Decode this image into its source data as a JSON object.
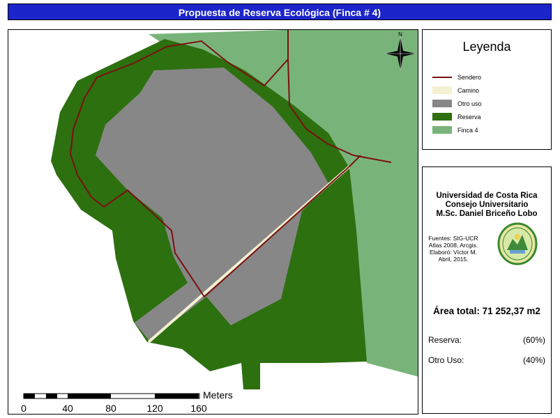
{
  "title": "Propuesta de Reserva Ecológica (Finca # 4)",
  "north_label": "N",
  "legend": {
    "title": "Leyenda",
    "items": [
      {
        "label": "Sendero",
        "color": "#7a1010",
        "kind": "line"
      },
      {
        "label": "Camino",
        "color": "#f4f1d2",
        "kind": "fill"
      },
      {
        "label": "Otro uso",
        "color": "#878787",
        "kind": "fill"
      },
      {
        "label": "Reserva",
        "color": "#2d7010",
        "kind": "fill"
      },
      {
        "label": "Finca 4",
        "color": "#78b47a",
        "kind": "fill"
      }
    ]
  },
  "info": {
    "institution": [
      "Universidad de Costa Rica",
      "Consejo Universitario",
      "M.Sc. Daniel Briceño Lobo"
    ],
    "sources": [
      "Fuentes: SIG-UCR",
      "Atlas 2008, Arcgis.",
      "Elaboró: Víctor M.",
      "Abril, 2015."
    ],
    "area_total": "Área total: 71 252,37 m2",
    "rows": [
      {
        "label": "Reserva:",
        "value": "(60%)"
      },
      {
        "label": "Otro Uso:",
        "value": "(40%)"
      }
    ]
  },
  "scale": {
    "unit": "Meters",
    "ticks": [
      "0",
      "40",
      "80",
      "120",
      "160"
    ]
  },
  "colors": {
    "title_bar": "#1c25c9",
    "finca": "#78b47a",
    "reserva": "#2d7010",
    "otro_uso": "#878787",
    "camino": "#f4f1d2",
    "sendero": "#7a1010"
  }
}
